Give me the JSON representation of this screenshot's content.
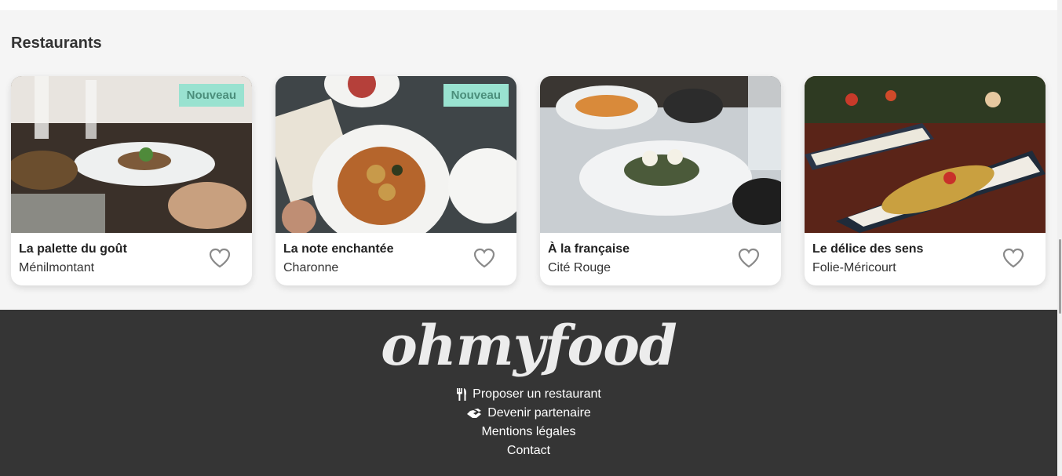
{
  "section": {
    "title": "Restaurants"
  },
  "restaurants": [
    {
      "name": "La palette du goût",
      "location": "Ménilmontant",
      "badge": "Nouveau",
      "favorite_icon": "heart-outline-icon"
    },
    {
      "name": "La note enchantée",
      "location": "Charonne",
      "badge": "Nouveau",
      "favorite_icon": "heart-outline-icon"
    },
    {
      "name": "À la française",
      "location": "Cité Rouge",
      "badge": "",
      "favorite_icon": "heart-outline-icon"
    },
    {
      "name": "Le délice des sens",
      "location": "Folie-Méricourt",
      "badge": "",
      "favorite_icon": "heart-outline-icon"
    }
  ],
  "footer": {
    "logo": "ohmyfood",
    "links": [
      {
        "label": "Proposer un restaurant",
        "icon": "utensils-icon"
      },
      {
        "label": "Devenir partenaire",
        "icon": "handshake-icon"
      },
      {
        "label": "Mentions légales",
        "icon": ""
      },
      {
        "label": "Contact",
        "icon": ""
      }
    ]
  },
  "colors": {
    "badge_bg": "#99e2d0",
    "badge_text": "#4b8e7b",
    "footer_bg": "#353535",
    "page_bg": "#f5f5f5"
  }
}
